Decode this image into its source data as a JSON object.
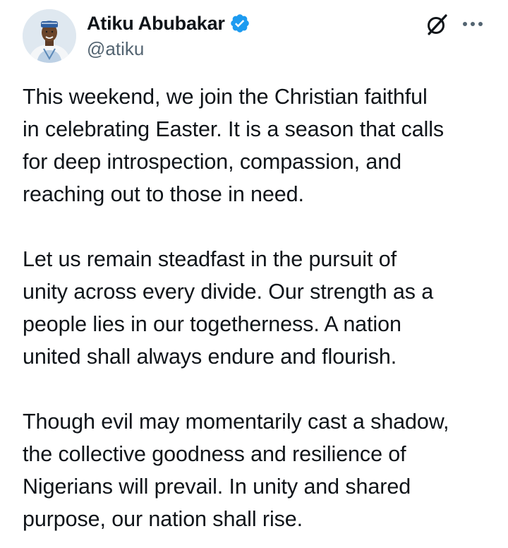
{
  "author": {
    "display_name": "Atiku Abubakar",
    "handle": "@atiku",
    "verified": true,
    "verified_color": "#1d9bf0"
  },
  "icons": {
    "verified": "verified-badge-icon",
    "grok": "grok-icon",
    "more": "more-options-icon"
  },
  "tweet": {
    "paragraphs": [
      "This weekend, we join the Christian faithful\nin celebrating Easter. It is a season that calls\nfor deep introspection, compassion, and\nreaching out to those in need.",
      "Let us remain steadfast in the pursuit of\nunity across every divide. Our strength as a\npeople lies in our togetherness. A nation\nunited shall always endure and flourish.",
      "Though evil may momentarily cast a shadow,\nthe collective goodness and resilience of\nNigerians will prevail. In unity and shared\npurpose, our nation shall rise."
    ]
  },
  "colors": {
    "text": "#0f1419",
    "secondary": "#536471",
    "accent": "#1d9bf0"
  }
}
